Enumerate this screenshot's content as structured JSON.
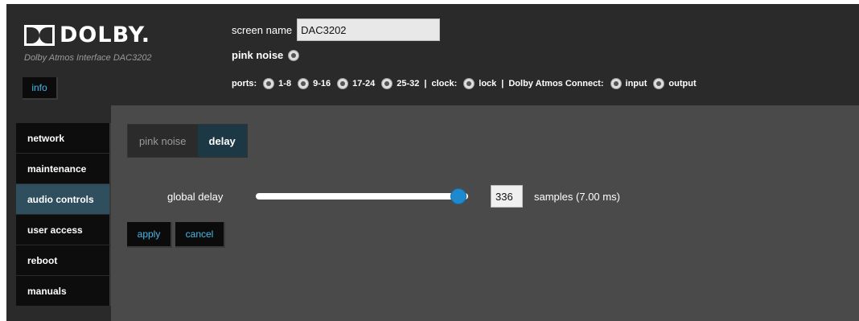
{
  "brand": {
    "name": "DOLBY.",
    "subtitle": "Dolby Atmos Interface DAC3202"
  },
  "header": {
    "info_label": "info",
    "screen_name_label": "screen name",
    "screen_name_value": "DAC3202",
    "pink_noise_label": "pink noise",
    "ports_label": "ports:",
    "ports": [
      "1-8",
      "9-16",
      "17-24",
      "25-32"
    ],
    "separator": "|",
    "clock_label": "clock:",
    "clock_option": "lock",
    "connect_label": "Dolby Atmos Connect:",
    "connect_options": [
      "input",
      "output"
    ]
  },
  "sidebar": {
    "items": [
      {
        "label": "network",
        "active": false
      },
      {
        "label": "maintenance",
        "active": false
      },
      {
        "label": "audio controls",
        "active": true
      },
      {
        "label": "user access",
        "active": false
      },
      {
        "label": "reboot",
        "active": false
      },
      {
        "label": "manuals",
        "active": false
      }
    ]
  },
  "main": {
    "tabs": [
      {
        "label": "pink noise",
        "active": false
      },
      {
        "label": "delay",
        "active": true
      }
    ],
    "global_delay_label": "global delay",
    "delay_value": "336",
    "slider_fraction": 0.99,
    "samples_text": "samples (7.00 ms)",
    "apply_label": "apply",
    "cancel_label": "cancel"
  },
  "colors": {
    "accent_link": "#47b8e8",
    "slider_thumb": "#1f89cf",
    "active_tab": "#1c3844",
    "active_nav": "#2f4f5e"
  }
}
